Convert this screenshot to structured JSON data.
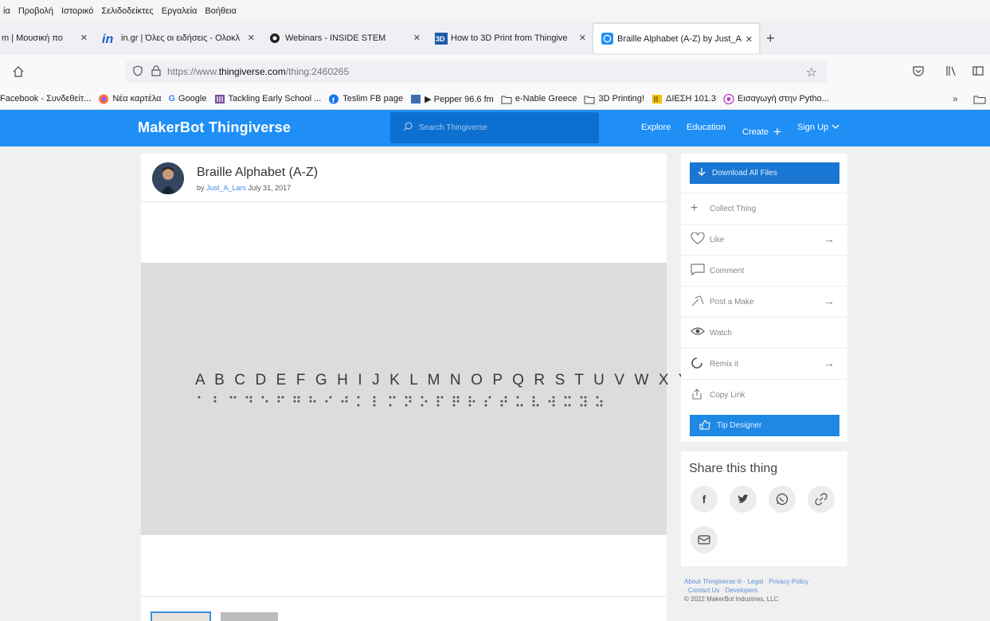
{
  "menu": [
    "ία",
    "Προβολή",
    "Ιστορικό",
    "Σελιδοδείκτες",
    "Εργαλεία",
    "Βοήθεια"
  ],
  "tabs": [
    {
      "label": "m | Μουσική πο"
    },
    {
      "label": "in.gr | Όλες οι ειδήσεις - Ολοκλ"
    },
    {
      "label": "Webinars - INSIDE STEM"
    },
    {
      "label": "How to 3D Print from Thingive"
    },
    {
      "label": "Braille Alphabet (A-Z) by Just_A"
    }
  ],
  "address": {
    "prefix": "https://www.",
    "domain": "thingiverse.com",
    "path": "/thing:2460265"
  },
  "bookmarks": [
    "Facebook - Συνδεθείτ...",
    "Νέα καρτέλα",
    "Google",
    "Tackling Early School ...",
    "Teslim FB page",
    "▶ Pepper 96.6 fm",
    "e-Nable Greece",
    "3D Printing!",
    "ΔΙΕΣΗ 101.3",
    "Εισαγωγή στην Pytho..."
  ],
  "site": {
    "logo": "MakerBot Thingiverse",
    "search_placeholder": "Search Thingiverse",
    "nav": {
      "explore": "Explore",
      "education": "Education",
      "create": "Create",
      "signup": "Sign Up"
    }
  },
  "thing": {
    "title": "Braille Alphabet (A-Z)",
    "by": "by",
    "author": "Just_A_Lars",
    "date": "July 31, 2017",
    "letters": "A B C D E F G H I J K L M N O P Q R S T U V W X Y Z"
  },
  "actions": {
    "download": "Download All Files",
    "collect": "Collect Thing",
    "like": "Like",
    "comment": "Comment",
    "post_make": "Post a Make",
    "watch": "Watch",
    "remix": "Remix it",
    "copy_link": "Copy Link",
    "tip": "Tip Designer"
  },
  "share": {
    "title": "Share this thing"
  },
  "footer": {
    "line1": "About Thingiverse ® · Legal · Privacy Policy",
    "line2": "· Contact Us · Developers",
    "line3": "© 2022 MakerBot Industries, LLC"
  },
  "colors": {
    "header": "#1f8ff6",
    "button": "#1976d2",
    "link": "#3b8ee0"
  }
}
